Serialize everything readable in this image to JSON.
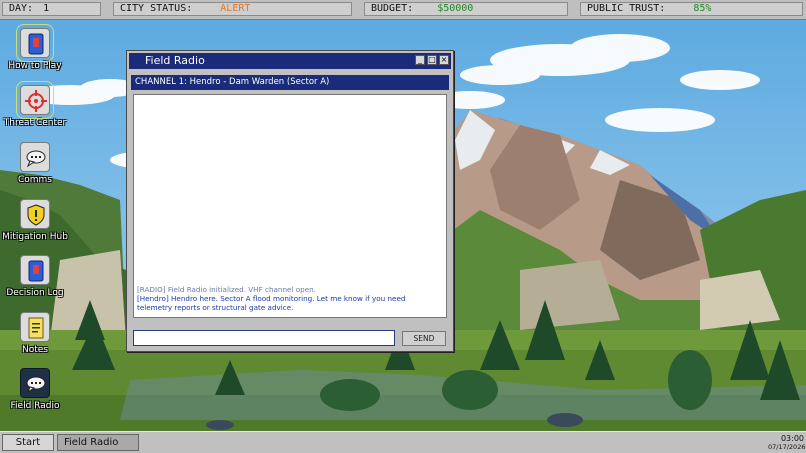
{
  "status": {
    "day_label": "DAY:",
    "day_value": "1",
    "city_label": "CITY STATUS:",
    "city_value": "ALERT",
    "budget_label": "BUDGET:",
    "budget_value": "$50000",
    "trust_label": "PUBLIC TRUST:",
    "trust_value": "85%"
  },
  "colors": {
    "alert": "#e8761b",
    "money": "#1f8a1f",
    "title_bar": "#1b2b7a"
  },
  "desktop_icons": [
    {
      "label": "How to Play",
      "icon": "book-icon"
    },
    {
      "label": "Threat Center",
      "icon": "crosshair-icon"
    },
    {
      "label": "Comms",
      "icon": "chat-icon"
    },
    {
      "label": "Mitigation Hub",
      "icon": "shield-alert-icon"
    },
    {
      "label": "Decision Log",
      "icon": "book-icon"
    },
    {
      "label": "Notes",
      "icon": "notepad-icon"
    },
    {
      "label": "Field Radio",
      "icon": "chat-icon"
    }
  ],
  "window": {
    "title": "Field Radio",
    "channel": "CHANNEL 1: Hendro - Dam Warden (Sector A)",
    "messages": [
      {
        "type": "system",
        "text": "[RADIO] Field Radio initialized. VHF channel open."
      },
      {
        "type": "contact",
        "text": "[Hendro] Hendro here. Sector A flood monitoring. Let me know if you need telemetry reports or structural gate advice."
      }
    ],
    "input_value": "",
    "send_label": "SEND"
  },
  "taskbar": {
    "start_label": "Start",
    "active_item": "Field Radio",
    "time": "03:00",
    "date": "07/17/2026"
  }
}
